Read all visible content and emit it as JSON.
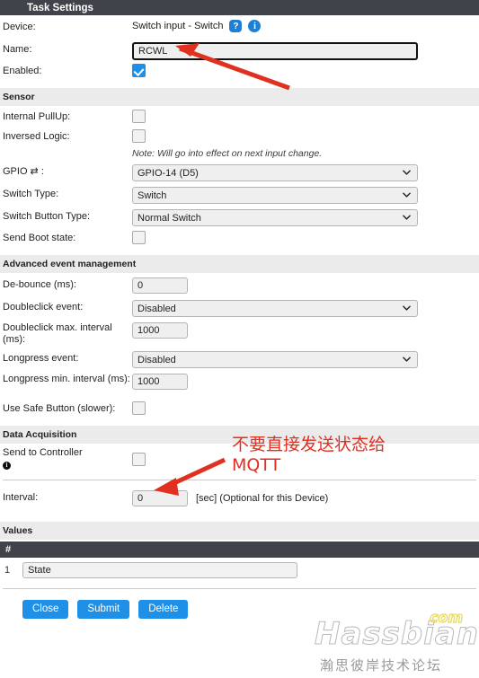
{
  "window": {
    "title": "Task Settings"
  },
  "device_row": {
    "label": "Device:",
    "value": "Switch input - Switch",
    "help_badge": "?",
    "info_badge": "i"
  },
  "name_row": {
    "label": "Name:",
    "value": "RCWL",
    "placeholder": ""
  },
  "enabled_row": {
    "label": "Enabled:",
    "checked": true
  },
  "sensor": {
    "header": "Sensor",
    "internal_pullup": {
      "label": "Internal PullUp:",
      "checked": false
    },
    "inversed_logic": {
      "label": "Inversed Logic:",
      "checked": false
    },
    "note": "Note: Will go into effect on next input change.",
    "gpio": {
      "label": "GPIO ⇄ :",
      "value": "GPIO-14 (D5)"
    },
    "switch_type": {
      "label": "Switch Type:",
      "value": "Switch"
    },
    "switch_button_type": {
      "label": "Switch Button Type:",
      "value": "Normal Switch"
    },
    "send_boot_state": {
      "label": "Send Boot state:",
      "checked": false
    }
  },
  "advanced": {
    "header": "Advanced event management",
    "debounce": {
      "label": "De-bounce (ms):",
      "value": "0"
    },
    "doubleclick_event": {
      "label": "Doubleclick event:",
      "value": "Disabled"
    },
    "doubleclick_interval": {
      "label": "Doubleclick max. interval (ms):",
      "value": "1000"
    },
    "longpress_event": {
      "label": "Longpress event:",
      "value": "Disabled"
    },
    "longpress_interval": {
      "label": "Longpress min. interval (ms):",
      "value": "1000"
    },
    "safe_button": {
      "label": "Use Safe Button (slower):",
      "checked": false
    }
  },
  "data_acquisition": {
    "header": "Data Acquisition",
    "send_to_controller": {
      "label": "Send to Controller",
      "checked": false,
      "info": "i"
    },
    "interval": {
      "label": "Interval:",
      "value": "0",
      "hint": "[sec] (Optional for this Device)"
    }
  },
  "values": {
    "header": "Values",
    "column_header": "#",
    "rows": [
      {
        "index": "1",
        "name": "State"
      }
    ]
  },
  "buttons": {
    "close": "Close",
    "submit": "Submit",
    "delete": "Delete"
  },
  "annotations": {
    "note_line1": "不要直接发送状态给",
    "note_line2": "MQTT",
    "arrow_color": "#e03020"
  },
  "watermark": {
    "main": "Hassbian",
    "com": "com",
    "chinese": "瀚思彼岸技术论坛"
  },
  "colors": {
    "titlebar_bg": "#41434a",
    "section_bg": "#ebebeb",
    "accent_blue": "#1e90e8",
    "badge_blue": "#1e7fd4",
    "annotation_red": "#e03020"
  }
}
